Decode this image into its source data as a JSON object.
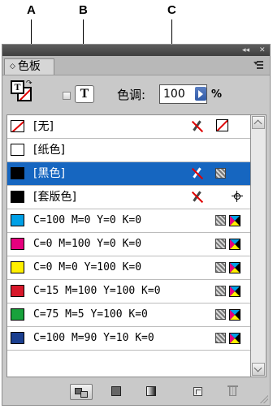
{
  "callouts": {
    "a": "A",
    "b": "B",
    "c": "C"
  },
  "panel": {
    "titlebar": {
      "collapse_glyph": "◂◂",
      "close_glyph": "✕"
    },
    "tab": {
      "chevron": "◇",
      "label": "色板"
    },
    "menu_icon": "panel-menu-icon"
  },
  "controls": {
    "fill_stroke_icon": "fill-stroke-icon",
    "format_text_glyph": "T",
    "tint_label": "色调:",
    "tint_value": "100",
    "tint_unit": "%"
  },
  "swatches": [
    {
      "name": "[无]",
      "color": "none",
      "mono": false,
      "non_editable": true,
      "right_icon": "none"
    },
    {
      "name": "[纸色]",
      "color": "#ffffff",
      "mono": false,
      "non_editable": false,
      "right_icon": ""
    },
    {
      "name": "[黑色]",
      "color": "#000000",
      "mono": false,
      "non_editable": true,
      "right_icon": "process",
      "selected": true
    },
    {
      "name": "[套版色]",
      "color": "#000000",
      "mono": false,
      "non_editable": true,
      "right_icon": "registration"
    },
    {
      "name": "C=100 M=0 Y=0 K=0",
      "color": "#00a0e6",
      "mono": true,
      "right_icon": "process-cmyk"
    },
    {
      "name": "C=0 M=100 Y=0 K=0",
      "color": "#e6007e",
      "mono": true,
      "right_icon": "process-cmyk"
    },
    {
      "name": "C=0 M=0 Y=100 K=0",
      "color": "#fff000",
      "mono": true,
      "right_icon": "process-cmyk"
    },
    {
      "name": "C=15 M=100 Y=100 K=0",
      "color": "#d7182a",
      "mono": true,
      "right_icon": "process-cmyk"
    },
    {
      "name": "C=75 M=5 Y=100 K=0",
      "color": "#18a23c",
      "mono": true,
      "right_icon": "process-cmyk"
    },
    {
      "name": "C=100 M=90 Y=10 K=0",
      "color": "#1b3f8f",
      "mono": true,
      "right_icon": "process-cmyk"
    }
  ],
  "bottom_toolbar": [
    "show-all-swatches-icon",
    "show-color-swatches-icon",
    "show-gradient-swatches-icon",
    "new-swatch-icon",
    "delete-swatch-icon"
  ],
  "colors": {
    "selection": "#1666c0",
    "panel_bg": "#c9c9c9",
    "titlebar": "#4a4a4a"
  }
}
